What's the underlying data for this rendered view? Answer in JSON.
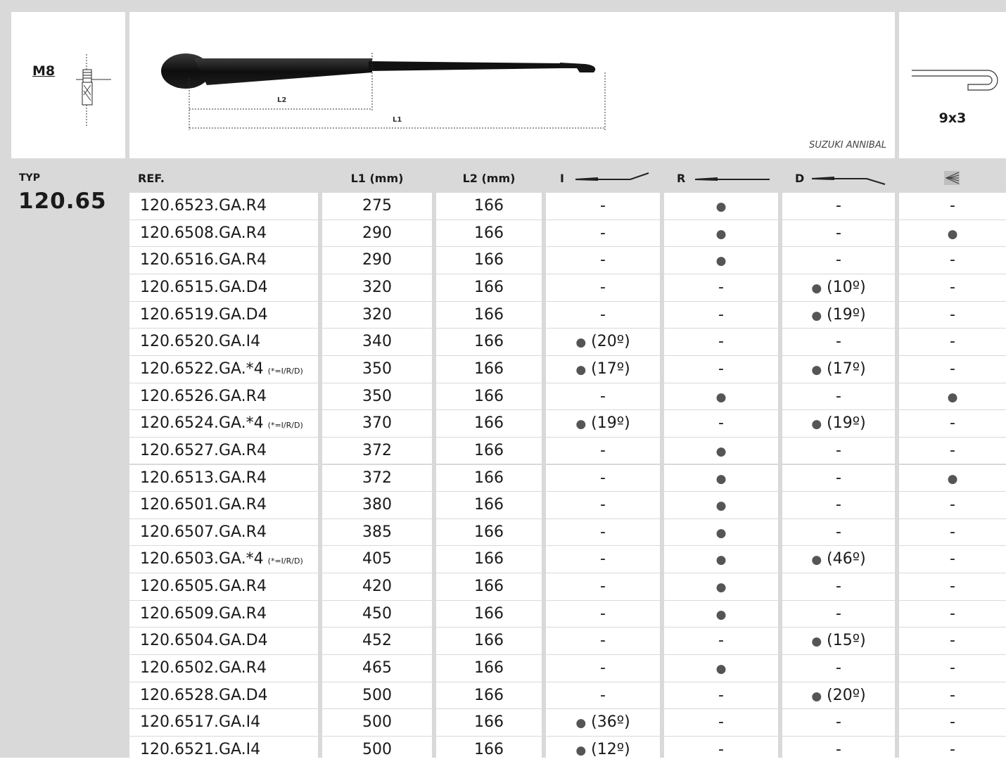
{
  "header": {
    "thread": "M8",
    "dim_l1": "L1",
    "dim_l2": "L2",
    "brand": "SUZUKI ANNIBAL",
    "profile_size": "9x3"
  },
  "type_label": "TYP",
  "type_value": "120.65",
  "columns": {
    "ref": "REF.",
    "l1": "L1 (mm)",
    "l2": "L2 (mm)",
    "i": "I",
    "r": "R",
    "d": "D"
  },
  "icons": {
    "i_col": "arm-bent-up-icon",
    "r_col": "arm-straight-icon",
    "d_col": "arm-bent-down-icon",
    "nozzle": "washer-nozzle-icon"
  },
  "rows": [
    {
      "ref": "120.6523.GA.R4",
      "note": "",
      "l1": "275",
      "l2": "166",
      "i": "-",
      "r": "●",
      "d": "-",
      "n": "-"
    },
    {
      "ref": "120.6508.GA.R4",
      "note": "",
      "l1": "290",
      "l2": "166",
      "i": "-",
      "r": "●",
      "d": "-",
      "n": "●"
    },
    {
      "ref": "120.6516.GA.R4",
      "note": "",
      "l1": "290",
      "l2": "166",
      "i": "-",
      "r": "●",
      "d": "-",
      "n": "-"
    },
    {
      "ref": "120.6515.GA.D4",
      "note": "",
      "l1": "320",
      "l2": "166",
      "i": "-",
      "r": "-",
      "d": "● (10º)",
      "n": "-"
    },
    {
      "ref": "120.6519.GA.D4",
      "note": "",
      "l1": "320",
      "l2": "166",
      "i": "-",
      "r": "-",
      "d": "● (19º)",
      "n": "-"
    },
    {
      "ref": "120.6520.GA.I4",
      "note": "",
      "l1": "340",
      "l2": "166",
      "i": "● (20º)",
      "r": "-",
      "d": "-",
      "n": "-"
    },
    {
      "ref": "120.6522.GA.*4",
      "note": "(*=I/R/D)",
      "l1": "350",
      "l2": "166",
      "i": "● (17º)",
      "r": "-",
      "d": "● (17º)",
      "n": "-"
    },
    {
      "ref": "120.6526.GA.R4",
      "note": "",
      "l1": "350",
      "l2": "166",
      "i": "-",
      "r": "●",
      "d": "-",
      "n": "●"
    },
    {
      "ref": "120.6524.GA.*4",
      "note": "(*=I/R/D)",
      "l1": "370",
      "l2": "166",
      "i": "● (19º)",
      "r": "-",
      "d": "● (19º)",
      "n": "-"
    },
    {
      "ref": "120.6527.GA.R4",
      "note": "",
      "l1": "372",
      "l2": "166",
      "i": "-",
      "r": "●",
      "d": "-",
      "n": "-"
    },
    {
      "ref": "120.6513.GA.R4",
      "note": "",
      "l1": "372",
      "l2": "166",
      "i": "-",
      "r": "●",
      "d": "-",
      "n": "●"
    },
    {
      "ref": "120.6501.GA.R4",
      "note": "",
      "l1": "380",
      "l2": "166",
      "i": "-",
      "r": "●",
      "d": "-",
      "n": "-"
    },
    {
      "ref": "120.6507.GA.R4",
      "note": "",
      "l1": "385",
      "l2": "166",
      "i": "-",
      "r": "●",
      "d": "-",
      "n": "-"
    },
    {
      "ref": "120.6503.GA.*4",
      "note": "(*=I/R/D)",
      "l1": "405",
      "l2": "166",
      "i": "-",
      "r": "●",
      "d": "● (46º)",
      "n": "-"
    },
    {
      "ref": "120.6505.GA.R4",
      "note": "",
      "l1": "420",
      "l2": "166",
      "i": "-",
      "r": "●",
      "d": "-",
      "n": "-"
    },
    {
      "ref": "120.6509.GA.R4",
      "note": "",
      "l1": "450",
      "l2": "166",
      "i": "-",
      "r": "●",
      "d": "-",
      "n": "-"
    },
    {
      "ref": "120.6504.GA.D4",
      "note": "",
      "l1": "452",
      "l2": "166",
      "i": "-",
      "r": "-",
      "d": "● (15º)",
      "n": "-"
    },
    {
      "ref": "120.6502.GA.R4",
      "note": "",
      "l1": "465",
      "l2": "166",
      "i": "-",
      "r": "●",
      "d": "-",
      "n": "-"
    },
    {
      "ref": "120.6528.GA.D4",
      "note": "",
      "l1": "500",
      "l2": "166",
      "i": "-",
      "r": "-",
      "d": "● (20º)",
      "n": "-"
    },
    {
      "ref": "120.6517.GA.I4",
      "note": "",
      "l1": "500",
      "l2": "166",
      "i": "● (36º)",
      "r": "-",
      "d": "-",
      "n": "-"
    },
    {
      "ref": "120.6521.GA.I4",
      "note": "",
      "l1": "500",
      "l2": "166",
      "i": "● (12º)",
      "r": "-",
      "d": "-",
      "n": "-"
    }
  ],
  "colors": {
    "panel_gray": "#d9d9da",
    "cell_white": "#ffffff",
    "dot_gray": "#555555"
  }
}
